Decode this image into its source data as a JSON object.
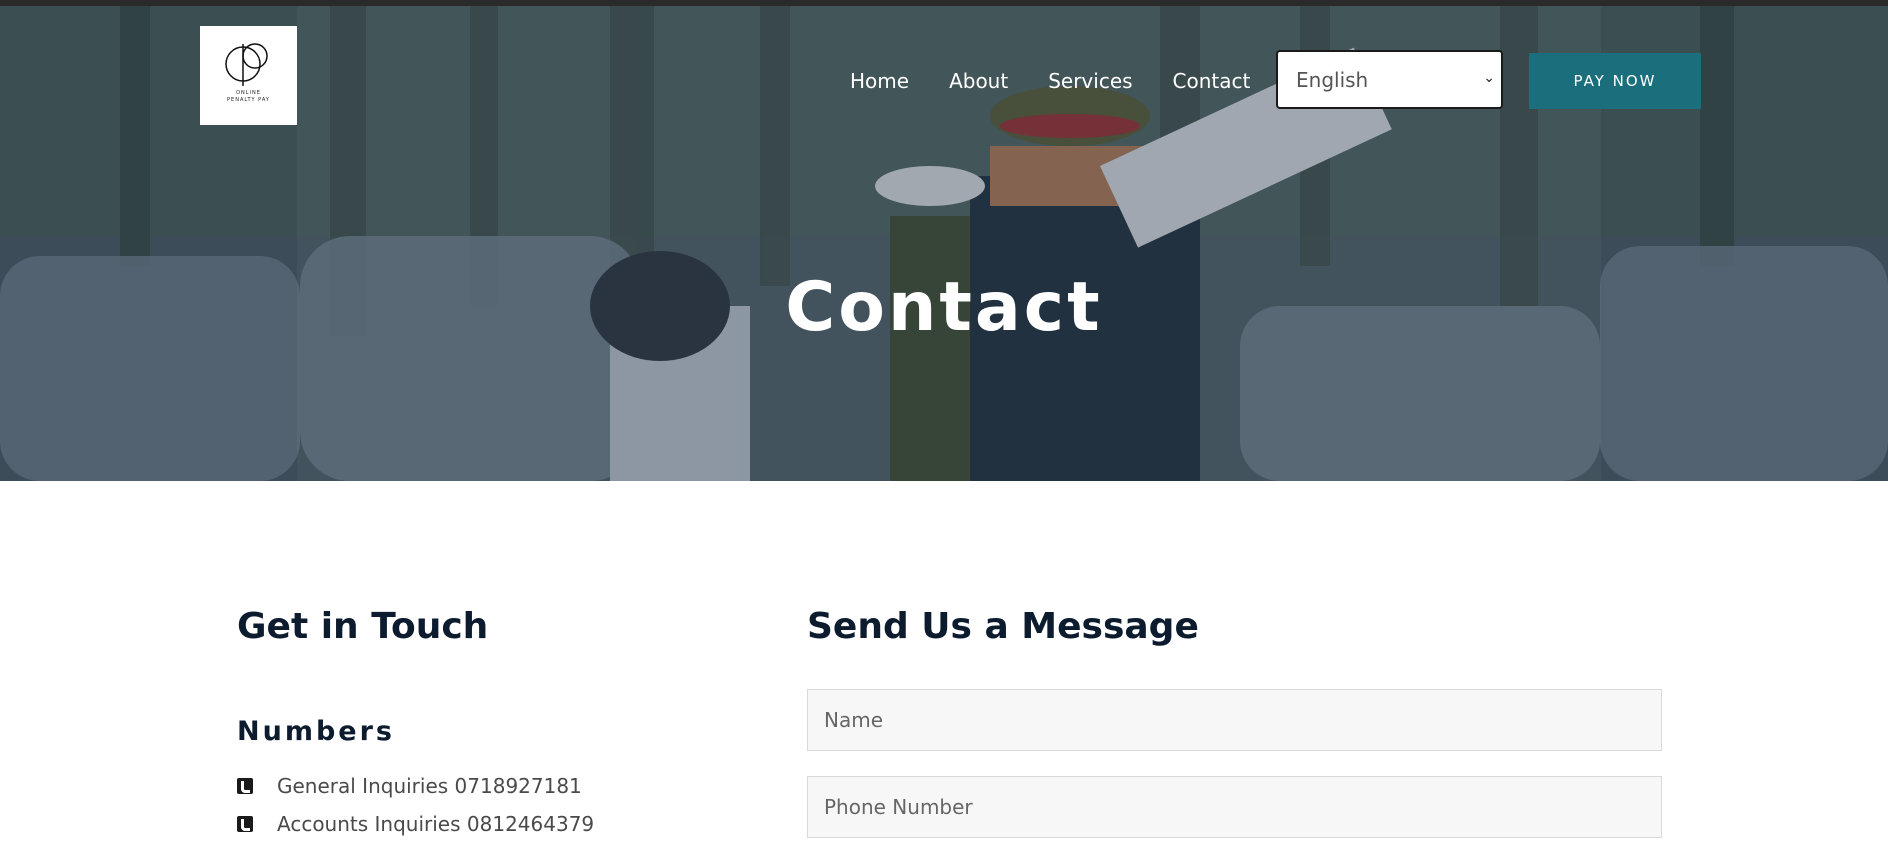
{
  "header": {
    "logo_alt": "Online Penalty Pay",
    "logo_line1": "ONLINE",
    "logo_line2": "PENALTY PAY",
    "nav": [
      "Home",
      "About",
      "Services",
      "Contact"
    ],
    "language": {
      "selected": "English"
    },
    "pay_button": "PAY NOW"
  },
  "hero": {
    "title": "Contact"
  },
  "get_in_touch": {
    "heading": "Get in Touch",
    "numbers_heading": "Numbers",
    "numbers": [
      {
        "icon": "phone-icon",
        "label": "General Inquiries 0718927181"
      },
      {
        "icon": "phone-icon",
        "label": "Accounts Inquiries 0812464379"
      }
    ]
  },
  "message_form": {
    "heading": "Send Us a Message",
    "name_placeholder": "Name",
    "phone_placeholder": "Phone Number"
  },
  "colors": {
    "accent": "#1b6e7b",
    "heading": "#0d1b2e",
    "hero_overlay": "#14283c"
  }
}
